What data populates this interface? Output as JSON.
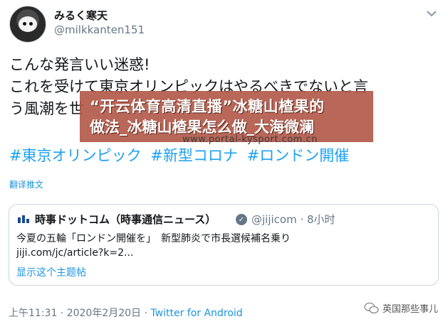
{
  "tweet": {
    "display_name": "みるく寒天",
    "handle": "@milkkanten151",
    "body_line1": "こんな発言いい迷惑!",
    "body_line2": "これを受けて東京オリンピックはやるべきでないと言",
    "body_line3": "う風潮を世",
    "hashtags": [
      "#東京オリンピック",
      "#新型コロナ",
      "#ロンドン開催"
    ],
    "translate_label": "翻译推文",
    "timestamp": "上午11:31 · 2020年2月20日 · ",
    "client": "Twitter for Android"
  },
  "overlay": {
    "title_line1": "“开云体育高清直播”冰糖山楂果的",
    "title_line2": "做法_冰糖山楂果怎么做_大海微澜",
    "watermark": "www.portal-kysport.com.cn"
  },
  "quoted": {
    "source_name": "時事ドットコム（時事通信ニュース）",
    "source_handle": "@jijicom · 8小时",
    "text_line1": "今夏の五輪「ロンドン開催を」　新型肺炎で市長選候補名乗り",
    "text_line2": "jiji.com/jc/article?k=2...",
    "show_thread": "显示这个主题帖"
  },
  "footer": {
    "wechat_label": "英国那些事儿"
  },
  "colors": {
    "link": "#1da1f2",
    "secondary": "#657786",
    "banner": "#b05646"
  }
}
